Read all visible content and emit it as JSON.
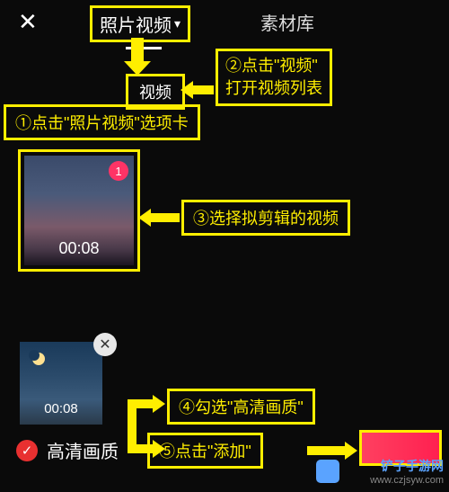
{
  "header": {
    "tab_photo_video": "照片视频",
    "tab_library": "素材库"
  },
  "video_button": "视频",
  "annotations": {
    "step1": "①点击\"照片视频\"选项卡",
    "step2_line1": "②点击\"视频\"",
    "step2_line2": "打开视频列表",
    "step3": "③选择拟剪辑的视频",
    "step4": "④勾选\"高清画质\"",
    "step5": "⑤点击\"添加\""
  },
  "thumbnail1": {
    "badge": "1",
    "duration": "00:08"
  },
  "thumbnail2": {
    "duration": "00:08"
  },
  "hd_quality_label": "高清画质",
  "close_symbol": "✕",
  "check_symbol": "✓",
  "caret_symbol": "▾",
  "watermark": {
    "site_name": "铲子手游网",
    "site_url": "www.czjsyw.com"
  }
}
